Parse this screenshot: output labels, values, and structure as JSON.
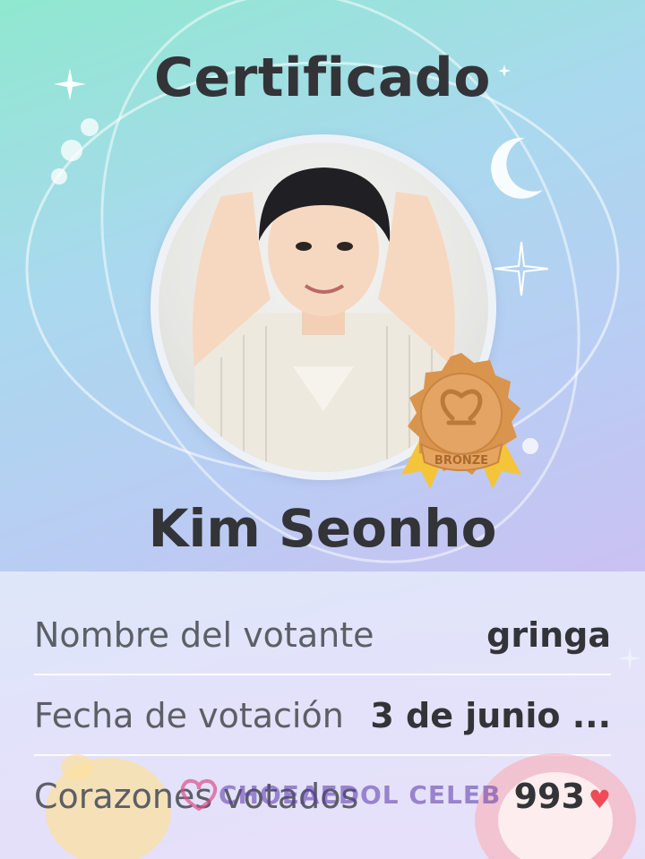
{
  "certificate": {
    "title": "Certificado",
    "celebrity_name": "Kim Seonho",
    "badge_text": "BRONZE"
  },
  "details": {
    "voter_label": "Nombre del votante",
    "voter_value": "gringa",
    "date_label": "Fecha de votación",
    "date_value": "3 de junio ...",
    "hearts_label": "Corazones votados",
    "hearts_value": "993"
  },
  "watermark": {
    "text": "CHOEAEDOL CELEB"
  },
  "icons": {
    "heart": "heart-icon",
    "badge": "bronze-medal-icon",
    "moon": "crescent-moon-icon",
    "star": "sparkle-icon"
  },
  "colors": {
    "heart": "#ef4b57",
    "badge": "#d9944e",
    "title_text": "#333438"
  }
}
